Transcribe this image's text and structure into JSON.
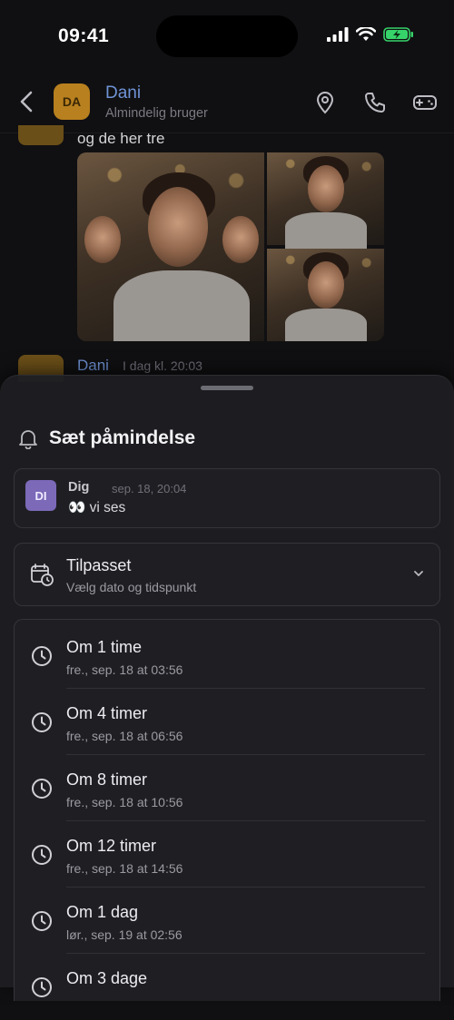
{
  "status_bar": {
    "time": "09:41"
  },
  "header": {
    "avatar_initials": "DA",
    "name": "Dani",
    "subtitle": "Almindelig bruger"
  },
  "chat": {
    "message_text": "og de her tre",
    "second_message": {
      "name": "Dani",
      "time": "I dag kl. 20:03"
    }
  },
  "sheet": {
    "title": "Sæt påmindelse",
    "message": {
      "avatar_initials": "DI",
      "author": "Dig",
      "time": "sep. 18, 20:04",
      "text": "👀 vi ses"
    },
    "custom": {
      "title": "Tilpasset",
      "subtitle": "Vælg dato og tidspunkt"
    },
    "options": [
      {
        "title": "Om 1 time",
        "subtitle": "fre., sep. 18 at 03:56"
      },
      {
        "title": "Om 4 timer",
        "subtitle": "fre., sep. 18 at 06:56"
      },
      {
        "title": "Om 8 timer",
        "subtitle": "fre., sep. 18 at 10:56"
      },
      {
        "title": "Om 12 timer",
        "subtitle": "fre., sep. 18 at 14:56"
      },
      {
        "title": "Om 1 dag",
        "subtitle": "lør., sep. 19 at 02:56"
      },
      {
        "title": "Om 3 dage",
        "subtitle": ""
      }
    ]
  },
  "colors": {
    "accent_name": "#6f93d6",
    "avatar_da": "#b8801e",
    "avatar_di": "#7c69b8",
    "battery": "#36d36a"
  },
  "icons": {
    "header": [
      "back-icon",
      "location-pin-icon",
      "phone-icon",
      "gamepad-icon"
    ],
    "sheet": [
      "bell-icon",
      "calendar-clock-icon",
      "chevron-down-icon",
      "clock-icon"
    ],
    "status": [
      "signal-icon",
      "wifi-icon",
      "battery-icon"
    ]
  }
}
